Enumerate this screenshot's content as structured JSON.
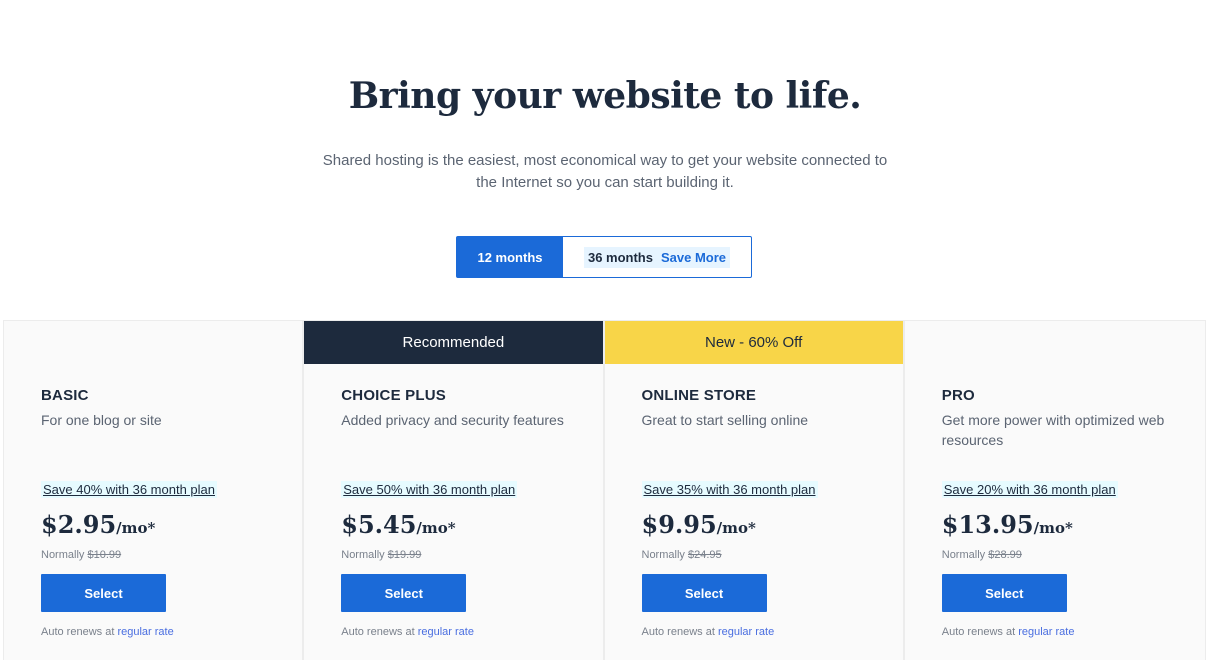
{
  "hero": {
    "title": "Bring your website to life.",
    "subtitle_line1": "Shared hosting is the easiest, most economical way to get your website connected to",
    "subtitle_line2": "the Internet so you can start building it."
  },
  "term_toggle": {
    "option_12": "12 months",
    "option_36": "36 months",
    "save_more": "Save More",
    "selected": "12 months"
  },
  "colors": {
    "primary_blue": "#1b6ad8",
    "navy": "#1d2a3d",
    "banner_yellow": "#f8d548"
  },
  "plans": [
    {
      "banner": "",
      "name": "BASIC",
      "description": "For one blog or site",
      "save_text": "Save 40% with 36 month plan",
      "price": "$2.95",
      "unit": "/mo*",
      "normally_label": "Normally",
      "normally_price": "$10.99",
      "button": "Select",
      "auto_renew_text": "Auto renews at",
      "auto_renew_link": "regular rate"
    },
    {
      "banner": "Recommended",
      "name": "CHOICE PLUS",
      "description": "Added privacy and security features",
      "save_text": "Save 50% with 36 month plan",
      "price": "$5.45",
      "unit": "/mo*",
      "normally_label": "Normally",
      "normally_price": "$19.99",
      "button": "Select",
      "auto_renew_text": "Auto renews at",
      "auto_renew_link": "regular rate"
    },
    {
      "banner": "New - 60% Off",
      "name": "ONLINE STORE",
      "description": "Great to start selling online",
      "save_text": "Save 35% with 36 month plan",
      "price": "$9.95",
      "unit": "/mo*",
      "normally_label": "Normally",
      "normally_price": "$24.95",
      "button": "Select",
      "auto_renew_text": "Auto renews at",
      "auto_renew_link": "regular rate"
    },
    {
      "banner": "",
      "name": "PRO",
      "description": "Get more power with optimized web resources",
      "save_text": "Save 20% with 36 month plan",
      "price": "$13.95",
      "unit": "/mo*",
      "normally_label": "Normally",
      "normally_price": "$28.99",
      "button": "Select",
      "auto_renew_text": "Auto renews at",
      "auto_renew_link": "regular rate"
    }
  ]
}
